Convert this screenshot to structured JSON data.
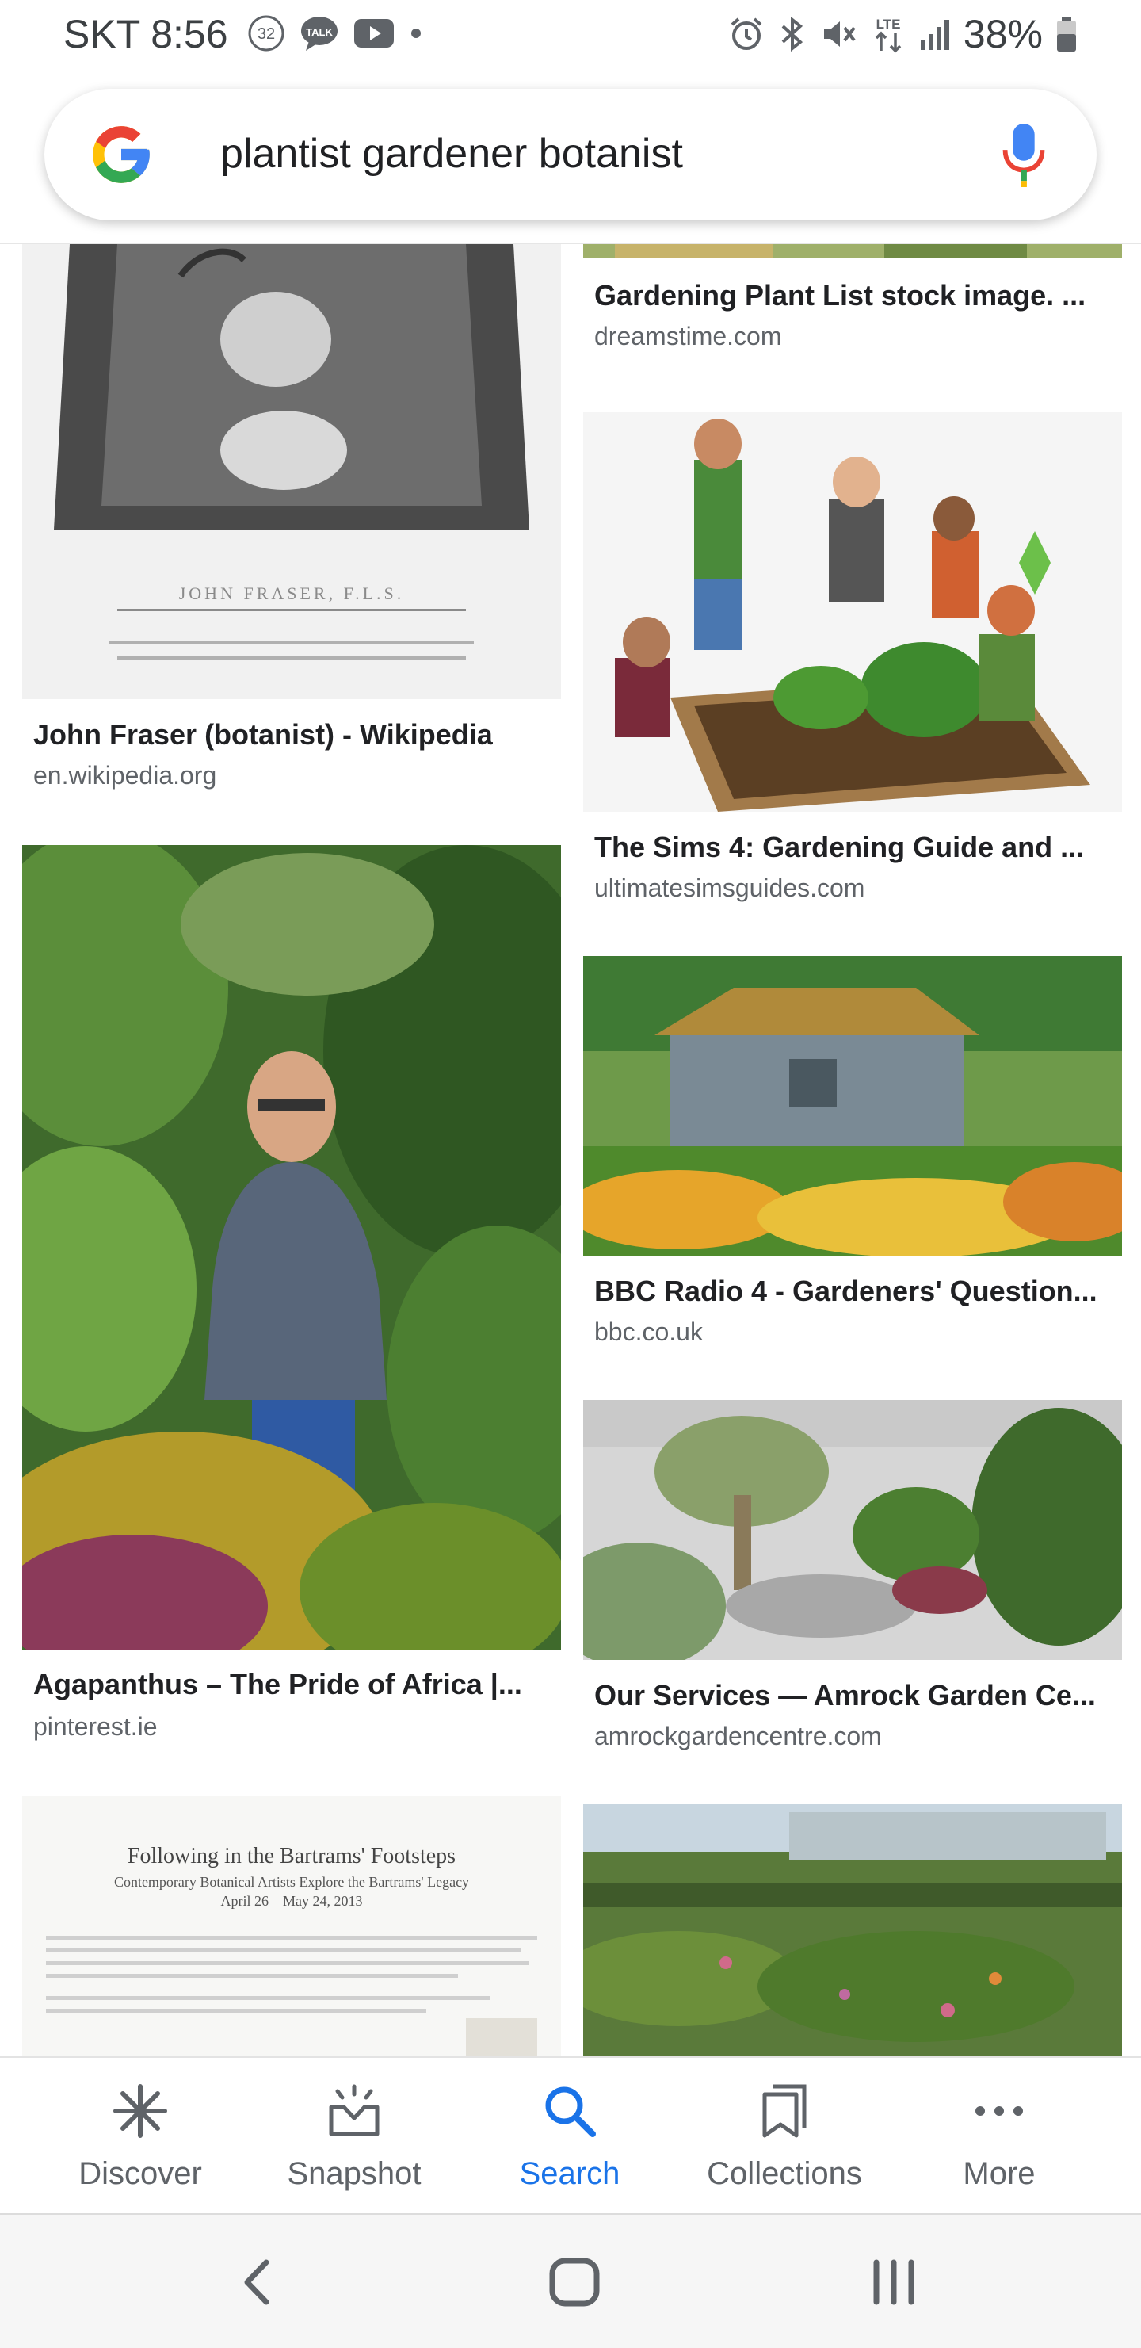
{
  "status_bar": {
    "carrier": "SKT",
    "time": "8:56",
    "notif_count": "32",
    "talk_label": "TALK",
    "network": "LTE",
    "battery": "38%"
  },
  "search": {
    "query": "plantist gardener botanist",
    "logo": "google-g-logo",
    "mic_icon": "mic-icon"
  },
  "results": {
    "left": [
      {
        "title": "John Fraser (botanist) - Wikipedia",
        "source": "en.wikipedia.org",
        "image_text": "JOHN FRASER, F.L.S."
      },
      {
        "title": "Agapanthus – The Pride of Africa |...",
        "source": "pinterest.ie"
      },
      {
        "title": "",
        "source": "",
        "image_heading": "Following in the Bartrams' Footsteps",
        "image_subheading": "Contemporary Botanical Artists Explore the Bartrams' Legacy",
        "image_dates": "April 26—May 24, 2013"
      }
    ],
    "right": [
      {
        "title": "Gardening Plant List stock image. ...",
        "source": "dreamstime.com"
      },
      {
        "title": "The Sims 4: Gardening Guide and ...",
        "source": "ultimatesimsguides.com"
      },
      {
        "title": "BBC Radio 4 - Gardeners' Question...",
        "source": "bbc.co.uk"
      },
      {
        "title": "Our Services — Amrock Garden Ce...",
        "source": "amrockgardencentre.com"
      },
      {
        "title": "",
        "source": ""
      }
    ]
  },
  "bottom_nav": [
    {
      "label": "Discover",
      "icon": "asterisk-icon",
      "active": false
    },
    {
      "label": "Snapshot",
      "icon": "snapshot-icon",
      "active": false
    },
    {
      "label": "Search",
      "icon": "search-icon",
      "active": true
    },
    {
      "label": "Collections",
      "icon": "collections-icon",
      "active": false
    },
    {
      "label": "More",
      "icon": "more-dots-icon",
      "active": false
    }
  ],
  "colors": {
    "accent": "#1a73e8",
    "text_primary": "#202124",
    "text_secondary": "#5f6368"
  }
}
